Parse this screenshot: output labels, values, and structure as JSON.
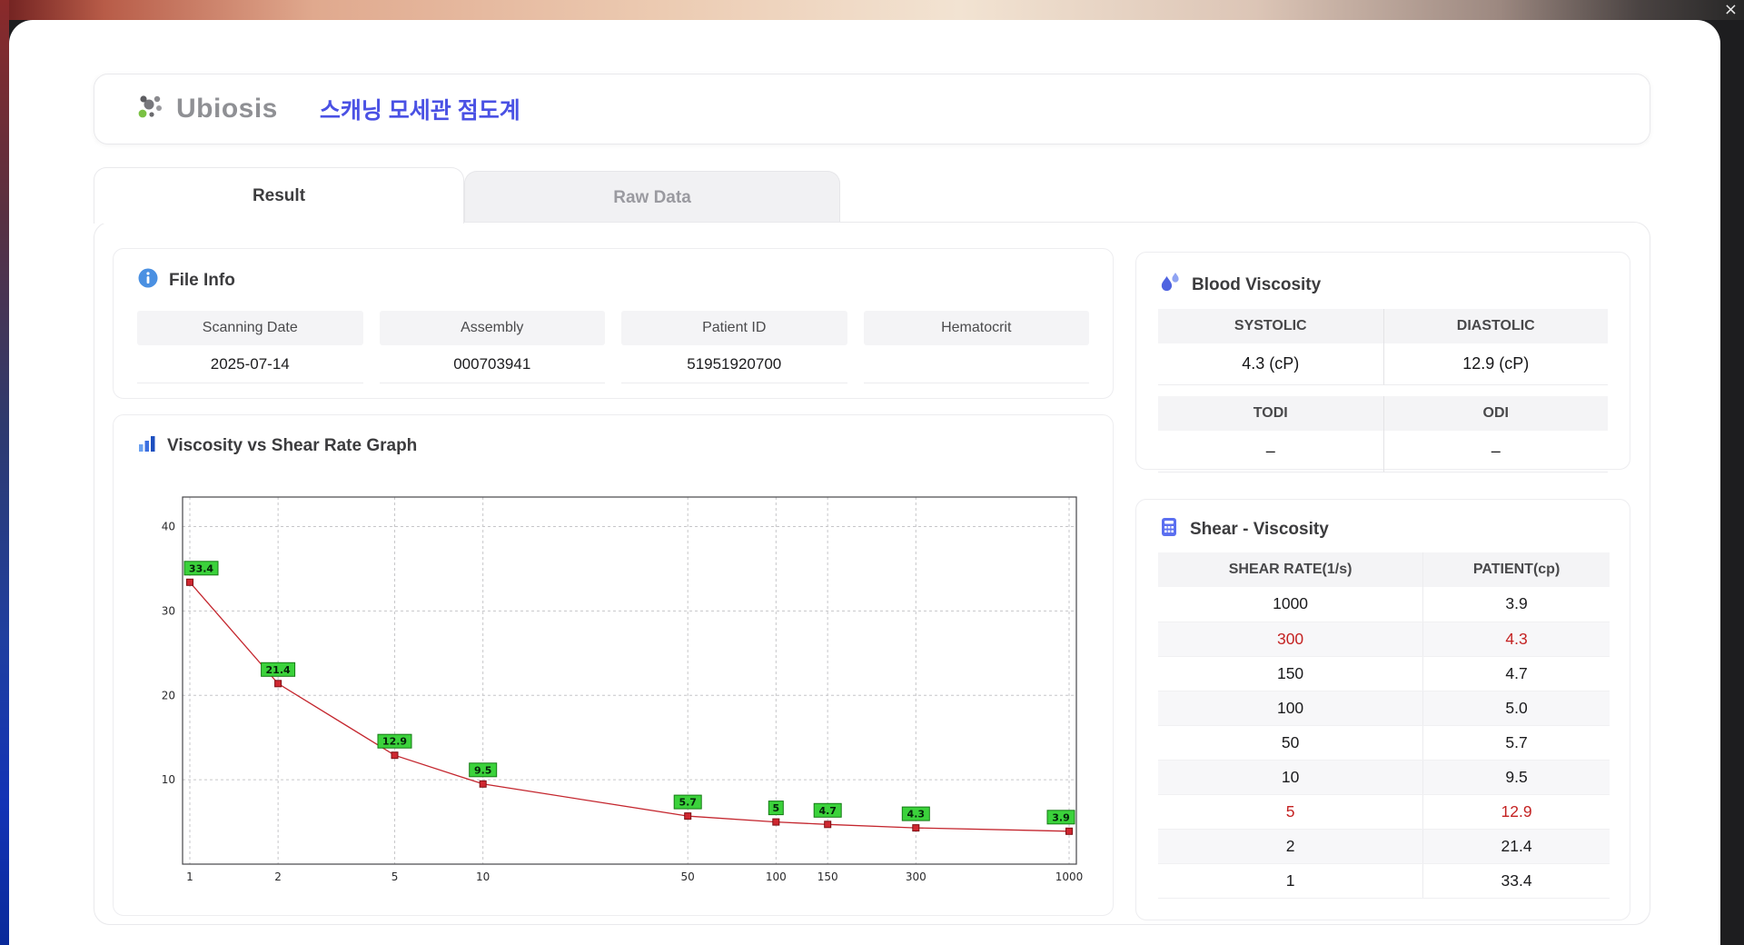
{
  "window": {
    "close_glyph": "×"
  },
  "header": {
    "logo_text": "Ubiosis",
    "title": "스캐닝 모세관 점도계"
  },
  "tabs": [
    {
      "label": "Result"
    },
    {
      "label": "Raw Data"
    }
  ],
  "file_info": {
    "title": "File Info",
    "fields": [
      {
        "label": "Scanning Date",
        "value": "2025-07-14"
      },
      {
        "label": "Assembly",
        "value": "000703941"
      },
      {
        "label": "Patient ID",
        "value": "51951920700"
      },
      {
        "label": "Hematocrit",
        "value": ""
      }
    ]
  },
  "graph": {
    "title": "Viscosity vs Shear Rate Graph"
  },
  "chart_data": {
    "type": "line",
    "title": "Viscosity vs Shear Rate Graph",
    "x": [
      1,
      2,
      5,
      10,
      50,
      100,
      150,
      300,
      1000
    ],
    "values": [
      33.4,
      21.4,
      12.9,
      9.5,
      5.7,
      5,
      4.7,
      4.3,
      3.9
    ],
    "point_labels": [
      "33.4",
      "21.4",
      "12.9",
      "9.5",
      "5.7",
      "5",
      "4.7",
      "4.3",
      "3.9"
    ],
    "x_scale": "log",
    "x_ticks": [
      1,
      2,
      5,
      10,
      50,
      100,
      150,
      300,
      1000
    ],
    "y_ticks": [
      10,
      20,
      30,
      40
    ],
    "ylim": [
      0,
      43.5
    ],
    "grid": true,
    "legend": "none",
    "xlabel": "",
    "ylabel": "",
    "line_color": "#c4262e",
    "marker_color": "#cf2730",
    "label_bg_color": "#3bd23b"
  },
  "blood_viscosity": {
    "title": "Blood Viscosity",
    "groups": [
      {
        "label1": "SYSTOLIC",
        "label2": "DIASTOLIC",
        "value1": "4.3 (cP)",
        "value2": "12.9 (cP)"
      },
      {
        "label1": "TODI",
        "label2": "ODI",
        "value1": "–",
        "value2": "–"
      }
    ]
  },
  "shear_viscosity": {
    "title": "Shear - Viscosity",
    "columns": [
      "SHEAR RATE(1/s)",
      "PATIENT(cp)"
    ],
    "rows": [
      {
        "rate": "1000",
        "patient": "3.9",
        "highlight": false
      },
      {
        "rate": "300",
        "patient": "4.3",
        "highlight": true
      },
      {
        "rate": "150",
        "patient": "4.7",
        "highlight": false
      },
      {
        "rate": "100",
        "patient": "5.0",
        "highlight": false
      },
      {
        "rate": "50",
        "patient": "5.7",
        "highlight": false
      },
      {
        "rate": "10",
        "patient": "9.5",
        "highlight": false
      },
      {
        "rate": "5",
        "patient": "12.9",
        "highlight": true
      },
      {
        "rate": "2",
        "patient": "21.4",
        "highlight": false
      },
      {
        "rate": "1",
        "patient": "33.4",
        "highlight": false
      }
    ]
  }
}
